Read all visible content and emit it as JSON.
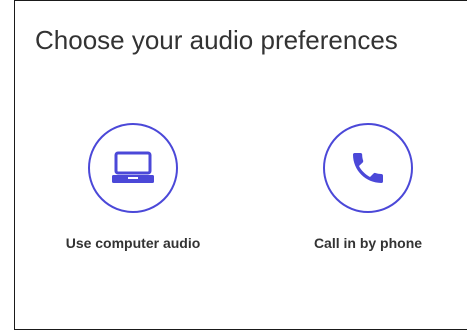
{
  "dialog": {
    "title": "Choose your audio preferences",
    "options": [
      {
        "label": "Use computer audio",
        "icon": "laptop-icon"
      },
      {
        "label": "Call in by phone",
        "icon": "phone-icon"
      }
    ]
  },
  "colors": {
    "accent": "#4b48d8",
    "text": "#333333",
    "border": "#1a1a1a",
    "background": "#ffffff"
  }
}
